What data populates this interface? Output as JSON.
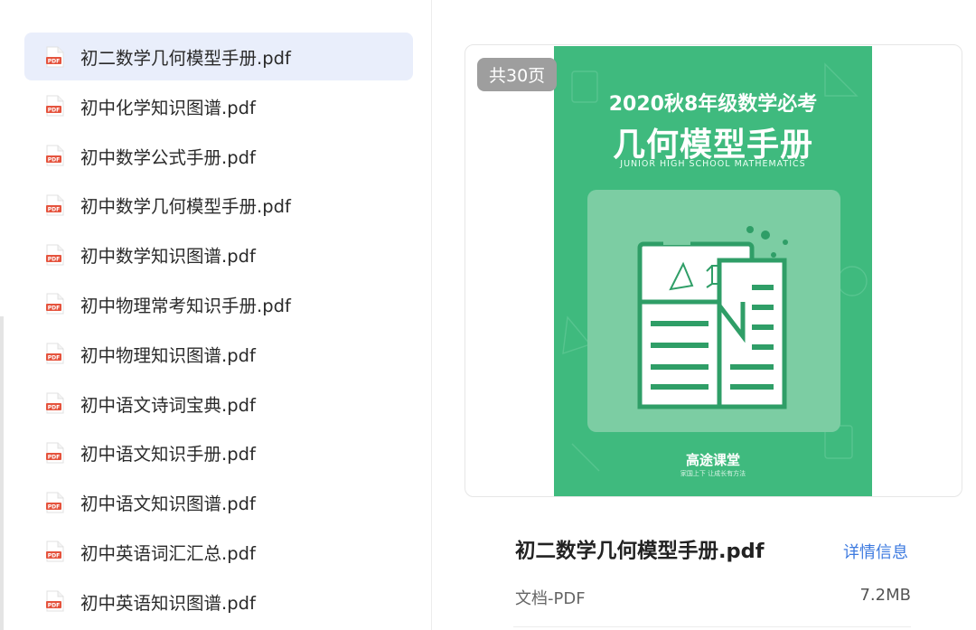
{
  "file_list": [
    {
      "name": "初二数学几何模型手册.pdf",
      "selected": true
    },
    {
      "name": "初中化学知识图谱.pdf"
    },
    {
      "name": "初中数学公式手册.pdf"
    },
    {
      "name": "初中数学几何模型手册.pdf"
    },
    {
      "name": "初中数学知识图谱.pdf"
    },
    {
      "name": "初中物理常考知识手册.pdf"
    },
    {
      "name": "初中物理知识图谱.pdf"
    },
    {
      "name": "初中语文诗词宝典.pdf"
    },
    {
      "name": "初中语文知识手册.pdf"
    },
    {
      "name": "初中语文知识图谱.pdf"
    },
    {
      "name": "初中英语词汇汇总.pdf"
    },
    {
      "name": "初中英语知识图谱.pdf"
    }
  ],
  "icons": {
    "file": "pdf-file-icon",
    "file_icon_label": "PDF"
  },
  "preview": {
    "page_count": "共30页",
    "cover": {
      "line1": "2020秋8年级数学必考",
      "title": "几何模型手册",
      "subtitle": "JUNIOR HIGH SCHOOL MATHEMATICS",
      "brand": "高途课堂",
      "slogan": "家国上下 让成长有方法"
    }
  },
  "details": {
    "name": "初二数学几何模型手册.pdf",
    "link": "详情信息",
    "type": "文档-PDF",
    "size": "7.2MB"
  },
  "colors": {
    "selected_bg": "#e9eefb",
    "cover_green": "#3fba7e",
    "link_blue": "#3e7be0",
    "pdf_red": "#e5533d"
  }
}
